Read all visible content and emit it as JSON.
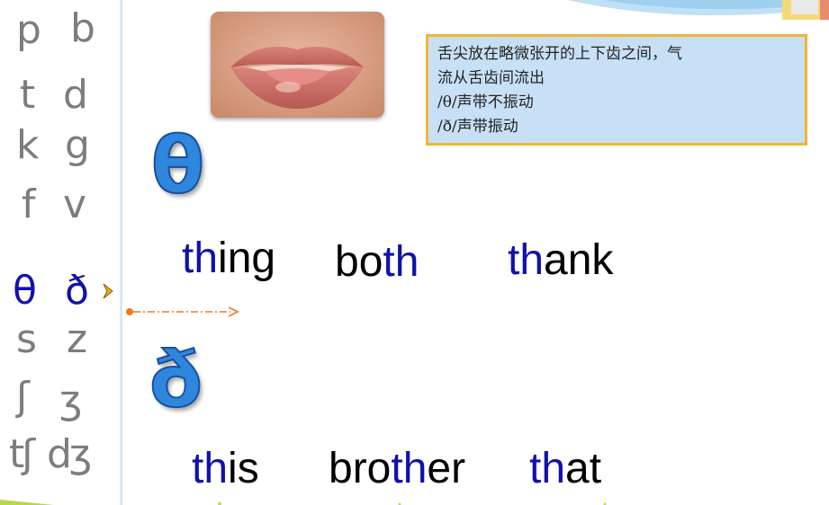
{
  "sidebar": {
    "symbols": [
      {
        "left": "p",
        "right": "b"
      },
      {
        "left": "t",
        "right": "d"
      },
      {
        "left": "k",
        "right": "g"
      },
      {
        "left": "f",
        "right": "v"
      },
      {
        "left": "θ",
        "right": "ð"
      },
      {
        "left": "s",
        "right": "z"
      },
      {
        "left": "ʃ",
        "right": "ʒ"
      },
      {
        "left": "tʃ",
        "right": "dʒ"
      }
    ],
    "active_row": 4
  },
  "note": {
    "line1": "舌尖放在略微张开的上下齿之间，气",
    "line2": "流从舌齿间流出",
    "line3": "/θ/声带不振动",
    "line4": "/ð/声带振动"
  },
  "theta": {
    "symbol": "θ",
    "words": [
      {
        "hl": "th",
        "rest": "ing",
        "pre": ""
      },
      {
        "pre": "bo",
        "hl": "th",
        "rest": ""
      },
      {
        "hl": "th",
        "rest": "ank",
        "pre": ""
      }
    ]
  },
  "eth": {
    "symbol": "ð",
    "words": [
      {
        "hl": "th",
        "rest": "is",
        "pre": ""
      },
      {
        "pre": "bro",
        "hl": "th",
        "rest": "er"
      },
      {
        "hl": "th",
        "rest": "at",
        "pre": ""
      }
    ]
  },
  "colors": {
    "highlight": "#1111aa",
    "symbol_fill": "#2f86dd",
    "note_bg": "#c7e0f6",
    "note_border": "#f0b535",
    "arrow": "#f07a1a",
    "grey_symbol": "#7d7d7d"
  },
  "icons": {
    "pointer": "chevron-right-icon",
    "mouth_image": "mouth-photo"
  }
}
